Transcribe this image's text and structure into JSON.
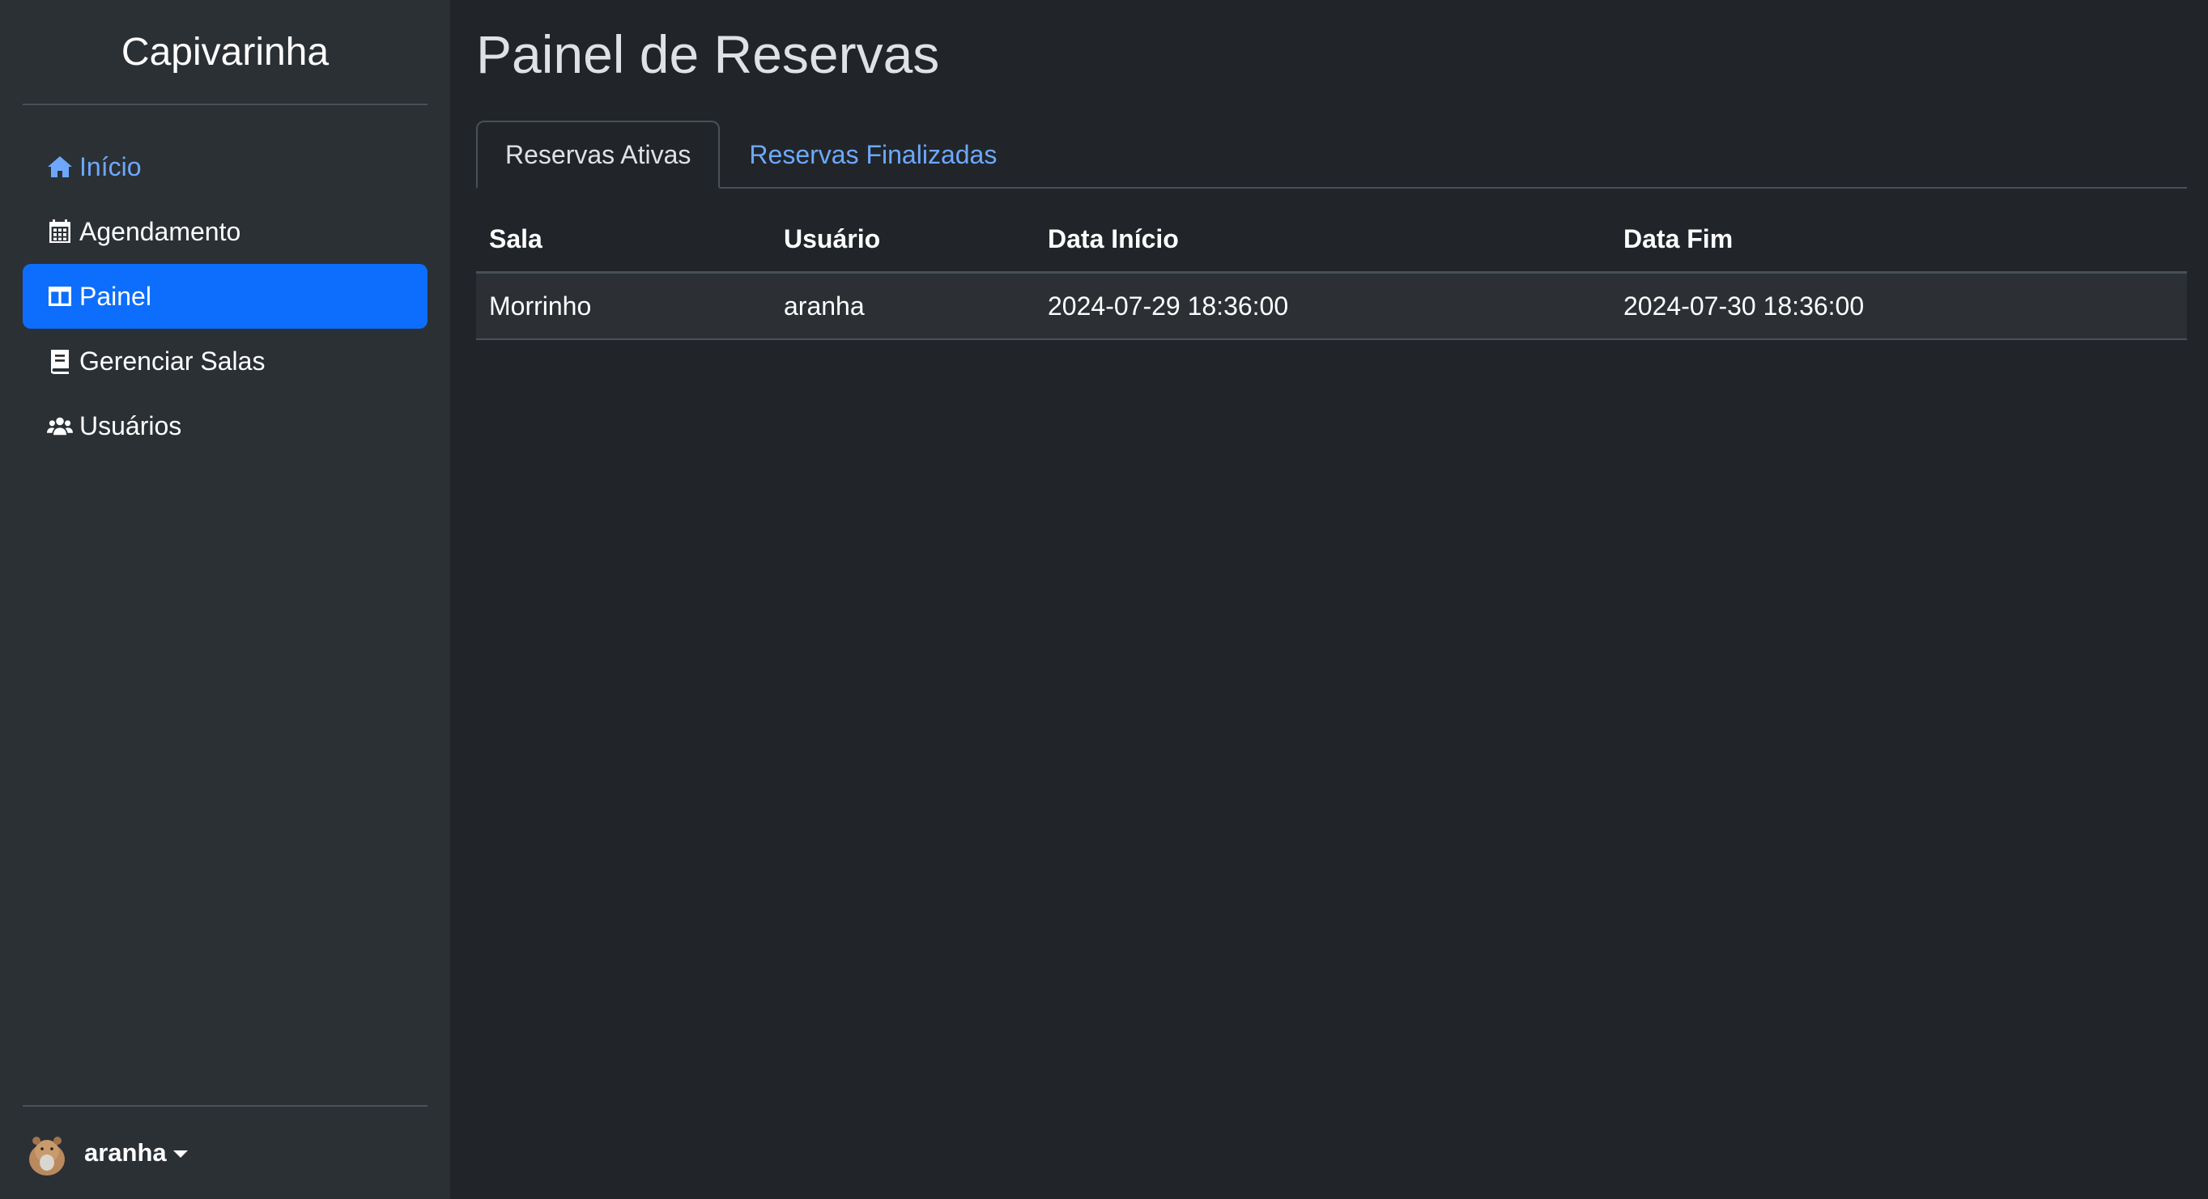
{
  "brand": "Capivarinha",
  "sidebar": {
    "items": [
      {
        "label": "Início",
        "icon": "house-icon"
      },
      {
        "label": "Agendamento",
        "icon": "calendar-icon"
      },
      {
        "label": "Painel",
        "icon": "panel-icon"
      },
      {
        "label": "Gerenciar Salas",
        "icon": "book-icon"
      },
      {
        "label": "Usuários",
        "icon": "users-icon"
      }
    ],
    "active_item": "Painel",
    "user": {
      "name": "aranha",
      "avatar": "capybara-avatar"
    }
  },
  "main": {
    "title": "Painel de Reservas",
    "tabs": [
      {
        "label": "Reservas Ativas",
        "active": true
      },
      {
        "label": "Reservas Finalizadas",
        "active": false
      }
    ],
    "table": {
      "headers": [
        "Sala",
        "Usuário",
        "Data Início",
        "Data Fim"
      ],
      "rows": [
        [
          "Morrinho",
          "aranha",
          "2024-07-29 18:36:00",
          "2024-07-30 18:36:00"
        ]
      ]
    }
  },
  "colors": {
    "background": "#212529",
    "sidebar": "#2b3035",
    "accent": "#0d6efd",
    "link": "#6ea8fe"
  }
}
